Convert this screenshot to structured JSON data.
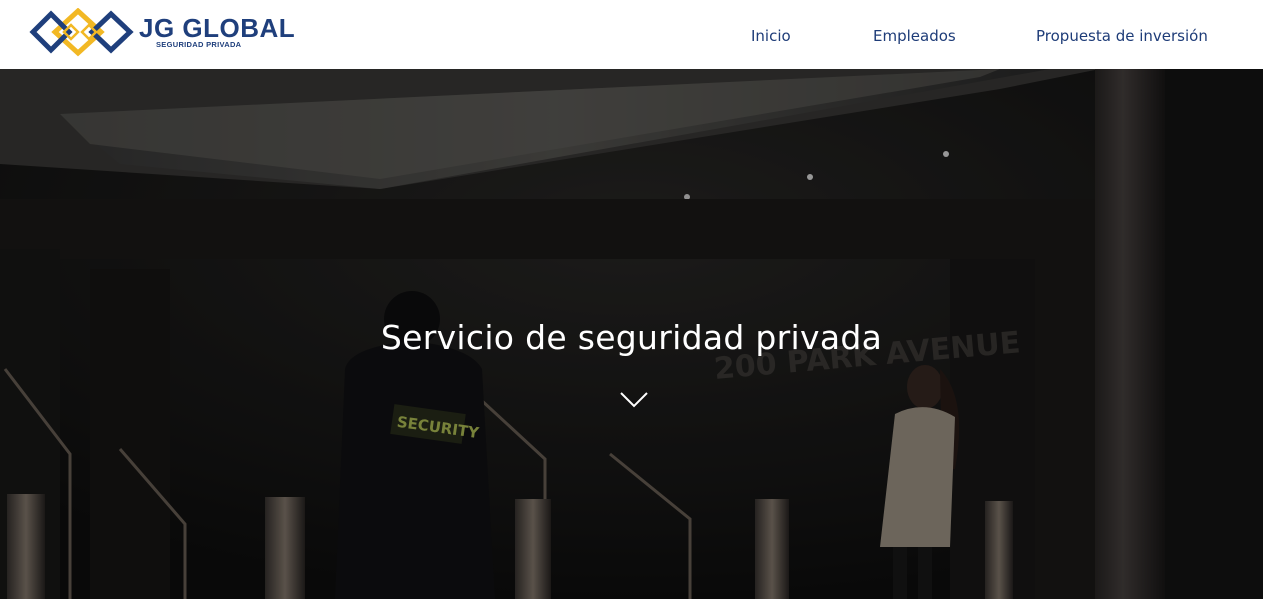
{
  "brand": {
    "title": "JG GLOBAL",
    "subtitle": "SEGURIDAD PRIVADA",
    "logo_colors": {
      "navy": "#1f3f7c",
      "gold": "#f2b824"
    }
  },
  "nav": {
    "items": [
      {
        "label": "Inicio"
      },
      {
        "label": "Empleados"
      },
      {
        "label": "Propuesta de inversión"
      }
    ],
    "color": "#1e3c78"
  },
  "hero": {
    "title": "Servicio de seguridad privada",
    "scroll_icon": "chevron-down-icon",
    "background_text": "200 PARK AVENUE",
    "badge_text": "SECURITY"
  }
}
